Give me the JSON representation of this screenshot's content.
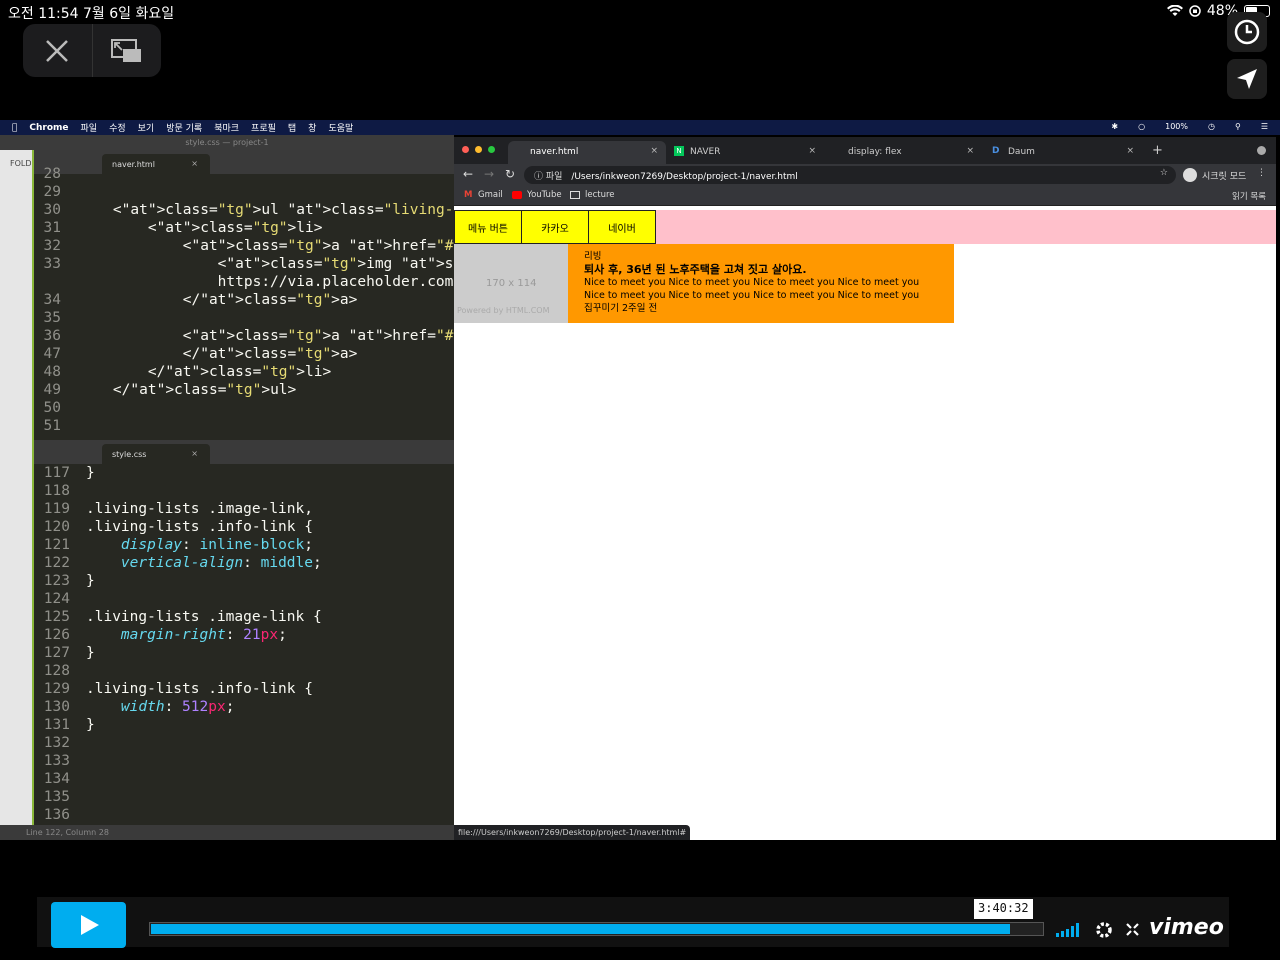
{
  "ios_status": {
    "time_date": "오전 11:54   7월 6일 화요일",
    "battery": "48%"
  },
  "mac_menu": [
    "Chrome",
    "파일",
    "수정",
    "보기",
    "방문 기록",
    "북마크",
    "프로필",
    "탭",
    "창",
    "도움말"
  ],
  "mac_menu_right": {
    "battery": "100%"
  },
  "sublime": {
    "title": "style.css — project-1",
    "sidebar_label": "FOLD",
    "top_tab": "naver.html",
    "bottom_tab": "style.css",
    "status": "Line 122, Column 28",
    "html_lines": [
      {
        "n": "28",
        "t": ""
      },
      {
        "n": "29",
        "t": ""
      },
      {
        "n": "30",
        "t": "<ul class=\"living-lists\">"
      },
      {
        "n": "31",
        "t": "<li>"
      },
      {
        "n": "32",
        "t": "<a href=\"#\" class=\"image-link\">"
      },
      {
        "n": "33",
        "t": "<img src=\""
      },
      {
        "n": "",
        "t": "https://via.placeholder.com"
      },
      {
        "n": "34",
        "t": "</a>"
      },
      {
        "n": "35",
        "t": ""
      },
      {
        "n": "36",
        "t": "<a href=\"#\" class=\"info-link\">"
      },
      {
        "n": "47",
        "t": "</a>"
      },
      {
        "n": "48",
        "t": "</li>"
      },
      {
        "n": "49",
        "t": "</ul>"
      },
      {
        "n": "50",
        "t": ""
      },
      {
        "n": "51",
        "t": ""
      }
    ],
    "css_lines": [
      {
        "n": "117",
        "t": "}"
      },
      {
        "n": "118",
        "t": ""
      },
      {
        "n": "119",
        "t": ".living-lists .image-link,"
      },
      {
        "n": "120",
        "t": ".living-lists .info-link {"
      },
      {
        "n": "121",
        "t": "display: inline-block;"
      },
      {
        "n": "122",
        "t": "vertical-align: middle;"
      },
      {
        "n": "123",
        "t": "}"
      },
      {
        "n": "124",
        "t": ""
      },
      {
        "n": "125",
        "t": ".living-lists .image-link {"
      },
      {
        "n": "126",
        "t": "margin-right: 21px;"
      },
      {
        "n": "127",
        "t": "}"
      },
      {
        "n": "128",
        "t": ""
      },
      {
        "n": "129",
        "t": ".living-lists .info-link {"
      },
      {
        "n": "130",
        "t": "width: 512px;"
      },
      {
        "n": "131",
        "t": "}"
      },
      {
        "n": "132",
        "t": ""
      },
      {
        "n": "133",
        "t": ""
      },
      {
        "n": "134",
        "t": ""
      },
      {
        "n": "135",
        "t": ""
      },
      {
        "n": "136",
        "t": ""
      }
    ]
  },
  "chrome": {
    "tabs": [
      "naver.html",
      "NAVER",
      "display: flex",
      "Daum"
    ],
    "address_scheme": "파일",
    "address": "/Users/inkweon7269/Desktop/project-1/naver.html",
    "profile": "시크릿 모드",
    "bookmarks": [
      "Gmail",
      "YouTube",
      "lecture"
    ],
    "reading_list": "읽기 목록",
    "status_url": "file:///Users/inkweon7269/Desktop/project-1/naver.html#"
  },
  "page": {
    "nav_buttons": [
      "메뉴 버튼",
      "카카오",
      "네이버"
    ],
    "placeholder_size": "170 x 114",
    "placeholder_credit": "Powered by HTML.COM",
    "category": "리빙",
    "headline": "퇴사 후, 36년 된 노후주택을 고쳐 짓고 살아요.",
    "body": "Nice to meet you Nice to meet you Nice to meet you Nice to meet you Nice to meet you Nice to meet you Nice to meet you Nice to meet you",
    "source": "집꾸미기 2주일 전"
  },
  "player": {
    "time": "3:40:32",
    "progress": 0.962,
    "brand": "vimeo"
  }
}
